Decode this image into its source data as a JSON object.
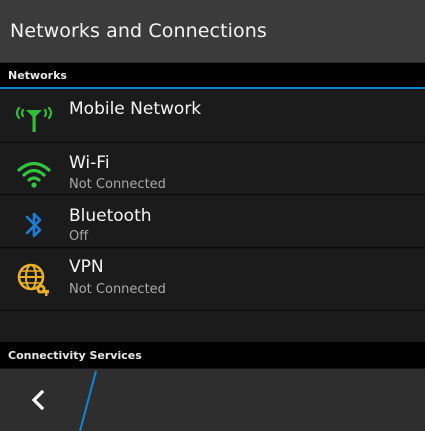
{
  "title": "Networks and Connections",
  "sections": {
    "networks": "Networks",
    "connectivity": "Connectivity Services"
  },
  "items": [
    {
      "label": "Mobile Network",
      "status": "",
      "icon": "mobile-network-icon"
    },
    {
      "label": "Wi-Fi",
      "status": "Not Connected",
      "icon": "wifi-icon"
    },
    {
      "label": "Bluetooth",
      "status": "Off",
      "icon": "bluetooth-icon"
    },
    {
      "label": "VPN",
      "status": "Not Connected",
      "icon": "vpn-icon"
    }
  ],
  "colors": {
    "accent_blue": "#0c87d6",
    "mobile_green": "#2fbf3a",
    "wifi_green": "#35c43f",
    "bluetooth_blue": "#1a7fd8",
    "vpn_yellow": "#e8b12a"
  },
  "bottom_bar": {
    "back_icon": "chevron-left-icon"
  }
}
